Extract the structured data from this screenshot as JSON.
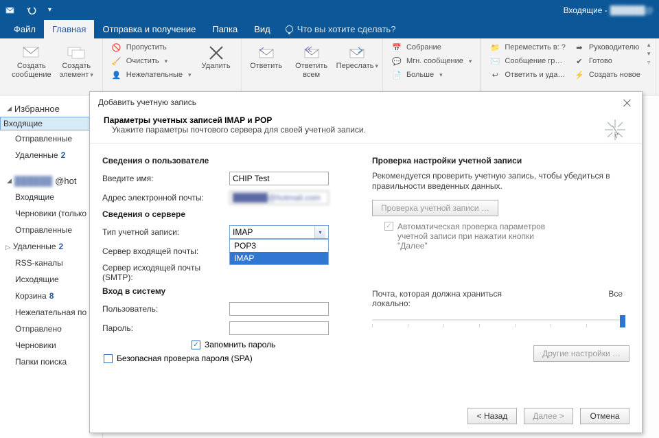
{
  "window_title_right": "Входящие -",
  "tabs": {
    "file": "Файл",
    "home": "Главная",
    "sendrecv": "Отправка и получение",
    "folder": "Папка",
    "view": "Вид",
    "tellme": "Что вы хотите сделать?"
  },
  "ribbon": {
    "new_msg": "Создать сообщение",
    "new_item": "Создать элемент",
    "skip": "Пропустить",
    "clean": "Очистить",
    "junk": "Нежелательные",
    "delete": "Удалить",
    "reply": "Ответить",
    "reply_all": "Ответить всем",
    "forward": "Переслать",
    "meeting": "Собрание",
    "im": "Мгн. сообщение",
    "more": "Больше",
    "move_to": "Переместить в: ?",
    "msg_grp": "Сообщение гр…",
    "reply_del": "Ответить и уда…",
    "to_manager": "Руководителю",
    "done": "Готово",
    "create_new": "Создать новое",
    "move": "Перемест"
  },
  "nav": {
    "favorites": "Избранное",
    "inbox": "Входящие",
    "sent": "Отправленные",
    "deleted": "Удаленные",
    "deleted_cnt": "2",
    "acct_suffix": "@hot",
    "drafts_only": "Черновики (только",
    "rss": "RSS-каналы",
    "outgoing": "Исходящие",
    "trash": "Корзина",
    "trash_cnt": "8",
    "junk_folder": "Нежелательная по",
    "sent2": "Отправлено",
    "drafts": "Черновики",
    "search": "Папки поиска"
  },
  "dialog": {
    "title": "Добавить учетную запись",
    "header_bold": "Параметры учетных записей IMAP и POP",
    "header_sub": "Укажите параметры почтового сервера для своей учетной записи.",
    "user_section": "Сведения о пользователе",
    "name_lbl": "Введите имя:",
    "name_val": "CHIP Test",
    "email_lbl": "Адрес электронной почты:",
    "email_val": "██████@hotmail.com",
    "server_section": "Сведения о сервере",
    "type_lbl": "Тип учетной записи:",
    "type_val": "IMAP",
    "opt_pop3": "POP3",
    "opt_imap": "IMAP",
    "in_server_lbl": "Сервер входящей почты:",
    "out_server_lbl": "Сервер исходящей почты (SMTP):",
    "login_section": "Вход в систему",
    "user_lbl": "Пользователь:",
    "pass_lbl": "Пароль:",
    "remember_pw": "Запомнить пароль",
    "spa": "Безопасная проверка пароля (SPA)",
    "check_section": "Проверка настройки учетной записи",
    "check_note": "Рекомендуется проверить учетную запись, чтобы убедиться в правильности введенных данных.",
    "check_btn": "Проверка учетной записи …",
    "auto_check": "Автоматическая проверка параметров учетной записи при нажатии кнопки \"Далее\"",
    "slider_lbl": "Почта, которая должна храниться локально:",
    "slider_val": "Все",
    "more_settings": "Другие настройки …",
    "back": "< Назад",
    "next": "Далее >",
    "cancel": "Отмена"
  }
}
